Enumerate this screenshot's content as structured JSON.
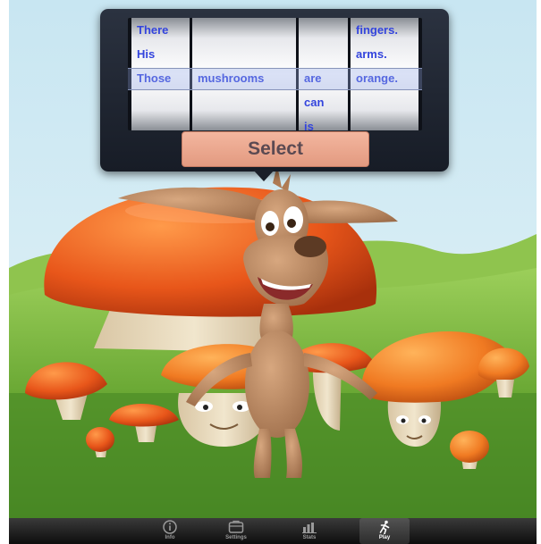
{
  "picker": {
    "columns": [
      {
        "items": [
          "There",
          "His",
          "Those",
          "",
          ""
        ],
        "selected": "Those"
      },
      {
        "items": [
          "",
          "",
          "mushrooms",
          "",
          ""
        ],
        "selected": "mushrooms"
      },
      {
        "items": [
          "",
          "",
          "are",
          "can",
          "is"
        ],
        "selected": "are"
      },
      {
        "items": [
          "fingers.",
          "arms.",
          "orange.",
          "",
          ""
        ],
        "selected": "orange."
      }
    ],
    "select_label": "Select"
  },
  "tabbar": {
    "tabs": [
      {
        "label": "Info",
        "icon": "info-icon",
        "active": false
      },
      {
        "label": "Settings",
        "icon": "settings-icon",
        "active": false
      },
      {
        "label": "Stats",
        "icon": "stats-icon",
        "active": false
      },
      {
        "label": "Play",
        "icon": "play-icon",
        "active": true
      }
    ]
  },
  "colors": {
    "word": "#3344dd",
    "select_button": "#eca78d",
    "tabbar": "#1a1a1a",
    "mushroom_cap": "#e0561c"
  }
}
